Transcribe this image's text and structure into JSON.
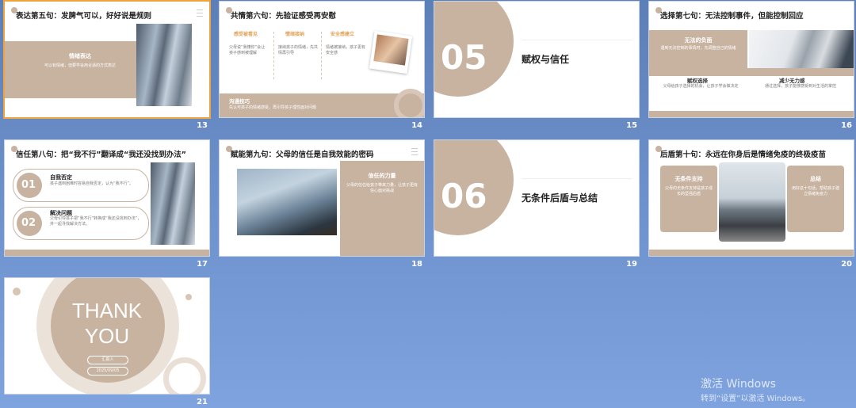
{
  "slides": {
    "s13": {
      "number": "13",
      "title": "表达第五句：发脾气可以，好好说是规则",
      "box_title": "情绪表达",
      "box_text": "可以有情绪，但要学会用合适的方式表达"
    },
    "s14": {
      "number": "14",
      "title": "共情第六句：先验证感受再安慰",
      "col1_title": "感受被看见",
      "col2_title": "情绪接纳",
      "col3_title": "安全感建立",
      "col1_text": "父母说“我懂你”会让孩子感到被理解",
      "col2_text": "接纳孩子的情绪，先共情再引导",
      "col3_text": "情绪被接纳，孩子更有安全感",
      "bottom_title": "沟通技巧",
      "bottom_text": "先认可孩子的情绪感受，再引导孩子理性面对问题"
    },
    "s15": {
      "number": "15",
      "big": "05",
      "text": "赋权与信任"
    },
    "s16": {
      "number": "16",
      "title": "选择第七句：无法控制事件，但能控制回应",
      "box_title": "无法的负面",
      "box_text": "遇到无法控制的事情时，先调整自己的情绪",
      "c1_title": "赋权选择",
      "c1_text": "父母给孩子选择的机会，让孩子学会做决定",
      "c2_title": "减少无力感",
      "c2_text": "通过选择，孩子能够感受到对生活的掌控"
    },
    "s17": {
      "number": "17",
      "title": "信任第八句：把“我不行”翻译成“我还没找到办法”",
      "i1_num": "01",
      "i1_title": "自我否定",
      "i1_text": "孩子遇到困难时容易自我否定，认为“我不行”。",
      "i2_num": "02",
      "i2_title": "解决问题",
      "i2_text": "父母引导孩子把“我不行”转换成“我还没找到办法”，并一起寻找解决方法。"
    },
    "s18": {
      "number": "18",
      "title": "赋能第九句：父母的信任是自我效能的密码",
      "box_title": "信任的力量",
      "box_text": "父母的信任给孩子带来力量，让孩子更有信心面对挑战"
    },
    "s19": {
      "number": "19",
      "big": "06",
      "text": "无条件后盾与总结"
    },
    "s20": {
      "number": "20",
      "title": "后盾第十句：永远在你身后是情绪免疫的终极疫苗",
      "l_title": "无条件支持",
      "l_text": "父母的无条件支持是孩子成长的坚强后盾",
      "r_title": "总结",
      "r_text": "用好这十句话，帮助孩子建立情绪免疫力"
    },
    "s21": {
      "number": "21",
      "thank": "THANK",
      "you": "YOU",
      "pill1": "汇报人",
      "pill2": "2025/09/05"
    }
  },
  "watermark": {
    "line1": "激活 Windows",
    "line2": "转到“设置”以激活 Windows。"
  },
  "colors": {
    "tan": "#c8b3a1",
    "selection": "#f0a33c",
    "background": "#6f93cf"
  }
}
